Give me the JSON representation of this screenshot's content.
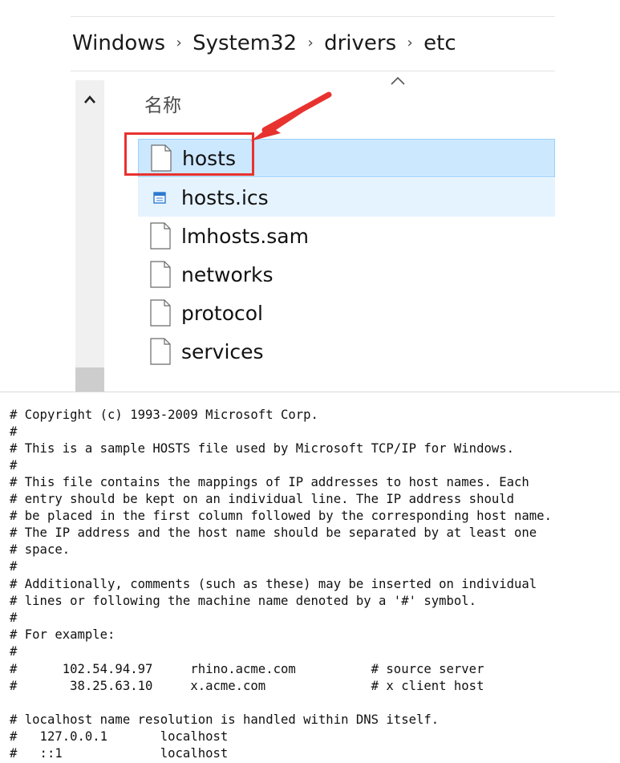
{
  "explorer": {
    "breadcrumb": [
      "Windows",
      "System32",
      "drivers",
      "etc"
    ],
    "column_header": "名称",
    "files": [
      {
        "name": "hosts",
        "icon": "text-file-icon",
        "state": "selected"
      },
      {
        "name": "hosts.ics",
        "icon": "ics-file-icon",
        "state": "hover"
      },
      {
        "name": "lmhosts.sam",
        "icon": "text-file-icon",
        "state": "normal"
      },
      {
        "name": "networks",
        "icon": "text-file-icon",
        "state": "normal"
      },
      {
        "name": "protocol",
        "icon": "text-file-icon",
        "state": "normal"
      },
      {
        "name": "services",
        "icon": "text-file-icon",
        "state": "normal"
      }
    ],
    "annotation_color": "#e8322f",
    "selection_color": "#cce8ff"
  },
  "hosts_file": {
    "lines": [
      "# Copyright (c) 1993-2009 Microsoft Corp.",
      "#",
      "# This is a sample HOSTS file used by Microsoft TCP/IP for Windows.",
      "#",
      "# This file contains the mappings of IP addresses to host names. Each",
      "# entry should be kept on an individual line. The IP address should",
      "# be placed in the first column followed by the corresponding host name.",
      "# The IP address and the host name should be separated by at least one",
      "# space.",
      "#",
      "# Additionally, comments (such as these) may be inserted on individual",
      "# lines or following the machine name denoted by a '#' symbol.",
      "#",
      "# For example:",
      "#",
      "#      102.54.94.97     rhino.acme.com          # source server",
      "#       38.25.63.10     x.acme.com              # x client host",
      "",
      "# localhost name resolution is handled within DNS itself.",
      "#   127.0.0.1       localhost",
      "#   ::1             localhost"
    ]
  }
}
